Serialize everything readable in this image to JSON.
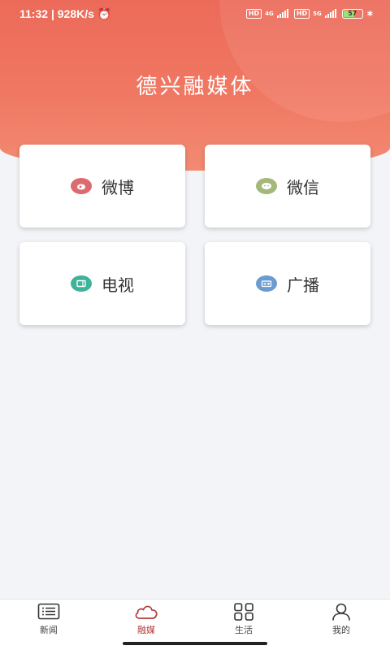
{
  "status": {
    "time": "11:32",
    "speed": "928K/s",
    "hd1": "HD",
    "net1": "4G",
    "hd2": "HD",
    "net2": "5G",
    "battery": "57"
  },
  "header": {
    "title": "德兴融媒体",
    "bg_color": "#ec6a59"
  },
  "cards": [
    {
      "label": "微博",
      "icon": "weibo-icon",
      "color": "#dc6a6e"
    },
    {
      "label": "微信",
      "icon": "wechat-icon",
      "color": "#a3b879"
    },
    {
      "label": "电视",
      "icon": "tv-icon",
      "color": "#3fb39a"
    },
    {
      "label": "广播",
      "icon": "radio-icon",
      "color": "#6c9bd1"
    }
  ],
  "tabs": [
    {
      "label": "新闻",
      "icon": "news-list-icon"
    },
    {
      "label": "融媒",
      "icon": "cloud-icon",
      "active": true
    },
    {
      "label": "生活",
      "icon": "grid-icon"
    },
    {
      "label": "我的",
      "icon": "user-icon"
    }
  ],
  "colors": {
    "active_tab": "#b23a3a",
    "page_bg": "#f2f4f7"
  }
}
